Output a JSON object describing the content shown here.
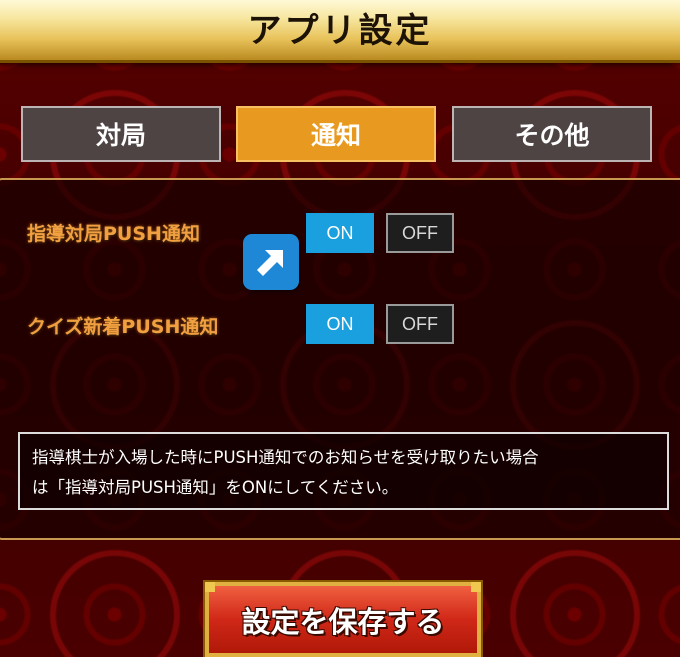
{
  "header": {
    "title": "アプリ設定"
  },
  "tabs": [
    {
      "label": "対局",
      "active": false
    },
    {
      "label": "通知",
      "active": true
    },
    {
      "label": "その他",
      "active": false
    }
  ],
  "settings": [
    {
      "label": "指導対局PUSH通知",
      "on_label": "ON",
      "off_label": "OFF",
      "selected": "ON"
    },
    {
      "label": "クイズ新着PUSH通知",
      "on_label": "ON",
      "off_label": "OFF",
      "selected": "ON"
    }
  ],
  "info": {
    "text": "指導棋士が入場した時にPUSH通知でのお知らせを受け取りたい場合\nは「指導対局PUSH通知」をONにしてください。"
  },
  "save_button": {
    "label": "設定を保存する"
  },
  "icons": {
    "arrow": "arrow-up-right-icon"
  },
  "colors": {
    "tab_active": "#e89a20",
    "tab_inactive": "#4e4444",
    "toggle_on": "#1aa0de",
    "toggle_off": "#1e1e1e",
    "label": "#f0a040",
    "save_button": "#d02818",
    "header_gold": "#e8c25a"
  }
}
